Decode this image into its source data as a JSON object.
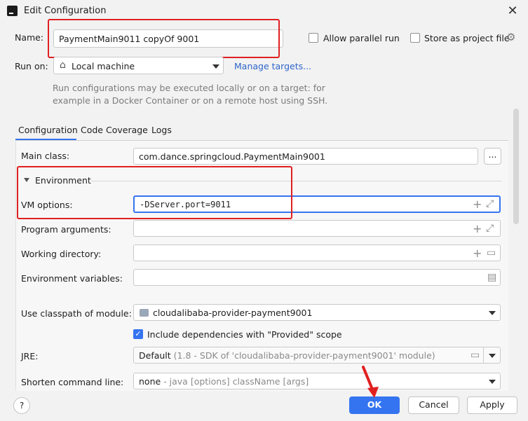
{
  "window": {
    "title": "Edit Configuration",
    "close_glyph": "✕"
  },
  "name_row": {
    "label": "Name:",
    "value": "PaymentMain9011 copyOf 9001",
    "allow_parallel_label": "Allow parallel run",
    "store_project_label": "Store as project file",
    "gear_glyph": "⚙"
  },
  "run_on": {
    "label": "Run on:",
    "value": "Local machine",
    "home_glyph": "⌂",
    "manage_link": "Manage targets...",
    "hint_line1": "Run configurations may be executed locally or on a target: for",
    "hint_line2": "example in a Docker Container or on a remote host using SSH."
  },
  "tabs": [
    {
      "label": "Configuration"
    },
    {
      "label": "Code Coverage"
    },
    {
      "label": "Logs"
    }
  ],
  "form": {
    "main_class_label": "Main class:",
    "main_class_value": "com.dance.springcloud.PaymentMain9001",
    "browse_label": "...",
    "environment_label": "Environment",
    "vm_options_label": "VM options:",
    "vm_options_value": "-DServer.port=9011",
    "program_args_label": "Program arguments:",
    "working_dir_label": "Working directory:",
    "env_vars_label": "Environment variables:",
    "classpath_label": "Use classpath of module:",
    "classpath_value": "cloudalibaba-provider-payment9001",
    "include_deps_label": "Include dependencies with \"Provided\" scope",
    "jre_label": "JRE:",
    "jre_value": "Default",
    "jre_detail": "(1.8 - SDK of 'cloudalibaba-provider-payment9001' module)",
    "shorten_label": "Shorten command line:",
    "shorten_value": "none",
    "shorten_detail": "- java [options] className [args]",
    "plus_glyph": "+",
    "expand_glyph": "⤢",
    "folder_glyph": "▭",
    "doc_glyph": "▤"
  },
  "footer": {
    "help_label": "?",
    "ok_label": "OK",
    "cancel_label": "Cancel",
    "apply_label": "Apply"
  },
  "colors": {
    "accent": "#3574f0",
    "annotation_red": "#e02020"
  }
}
